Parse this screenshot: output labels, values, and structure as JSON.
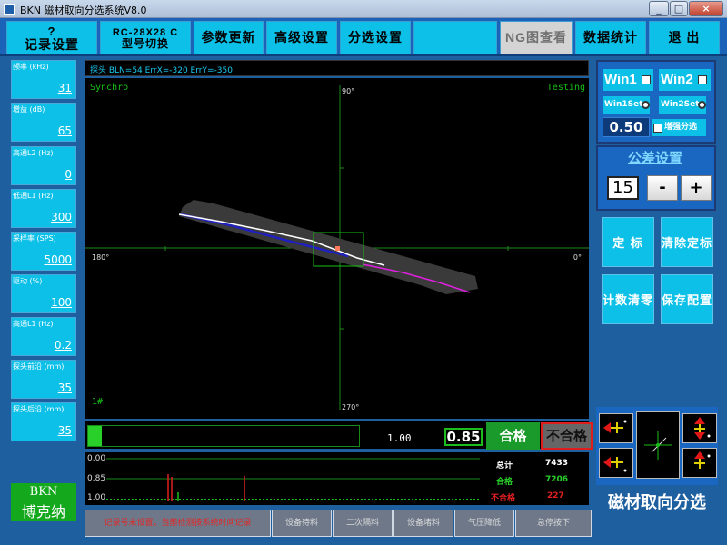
{
  "window": {
    "title": "BKN 磁材取向分选系统V8.0",
    "controls": {
      "minimize": "_",
      "maximize": "□",
      "close": "×"
    }
  },
  "toolbar": {
    "record_top": "?",
    "record_label": "记录设置",
    "model_top": "RC-28X28 C",
    "model_label": "型号切换",
    "params": "参数更新",
    "advanced": "高级设置",
    "sorting": "分选设置",
    "ng_chart_prefix": "NG",
    "ng_chart_rest": "图查看",
    "stats": "数据统计",
    "exit": "退 出"
  },
  "left_params": [
    {
      "label": "频率 (kHz)",
      "value": "31"
    },
    {
      "label": "增益 (dB)",
      "value": "65"
    },
    {
      "label": "高通L2 (Hz)",
      "value": "0"
    },
    {
      "label": "低通L1 (Hz)",
      "value": "300"
    },
    {
      "label": "采样率 (SPS)",
      "value": "5000"
    },
    {
      "label": "驱动 (%)",
      "value": "100"
    },
    {
      "label": "高通L1 (Hz)",
      "value": "0.2"
    },
    {
      "label": "探头前沿 (mm)",
      "value": "35"
    },
    {
      "label": "探头后沿 (mm)",
      "value": "35"
    }
  ],
  "logo": {
    "line1": "BKN",
    "line2": "博克纳"
  },
  "scope": {
    "header": "探头 BLN=54  ErrX=-320  ErrY=-350",
    "mode_left": "Synchro",
    "mode_right": "Testing",
    "angle_top": "90°",
    "angle_left": "180°",
    "angle_right": "0°",
    "angle_bottom": "270°",
    "probe_id": "1#",
    "colors": {
      "band": "#3a3a3a",
      "white_trace": "#ffffff",
      "blue_trace": "#1a1acc",
      "magenta_trace": "#e020e0",
      "window": "#18c018",
      "axis": "#1a8a1a"
    }
  },
  "result": {
    "value_left": "1.00",
    "value_box": "0.85",
    "pass_label": "合格",
    "fail_label": "不合格",
    "progress": 0.05
  },
  "histogram": {
    "labels": [
      "0.00",
      "0.85",
      "1.00"
    ]
  },
  "stats": {
    "total_label": "总计",
    "total": "7433",
    "pass_label": "合格",
    "pass": "7206",
    "fail_label": "不合格",
    "fail": "227"
  },
  "status_bar": [
    "记录号未设置，当前检测按系统时间记录",
    "设备待料",
    "二次隔料",
    "设备堵料",
    "气压降低",
    "急停按下"
  ],
  "right_panel": {
    "win1": "Win1",
    "win2": "Win2",
    "win1set": "Win1Set",
    "win2set": "Win2Set",
    "threshold": "0.50",
    "enhance": "增强分选",
    "tolerance_title": "公差设置",
    "tolerance_value": "15",
    "minus": "-",
    "plus": "+",
    "calibrate": "定 标",
    "clear_calibration": "清除定标",
    "clear_count": "计数清零",
    "save_config": "保存配置",
    "brand": "磁材取向分选"
  }
}
